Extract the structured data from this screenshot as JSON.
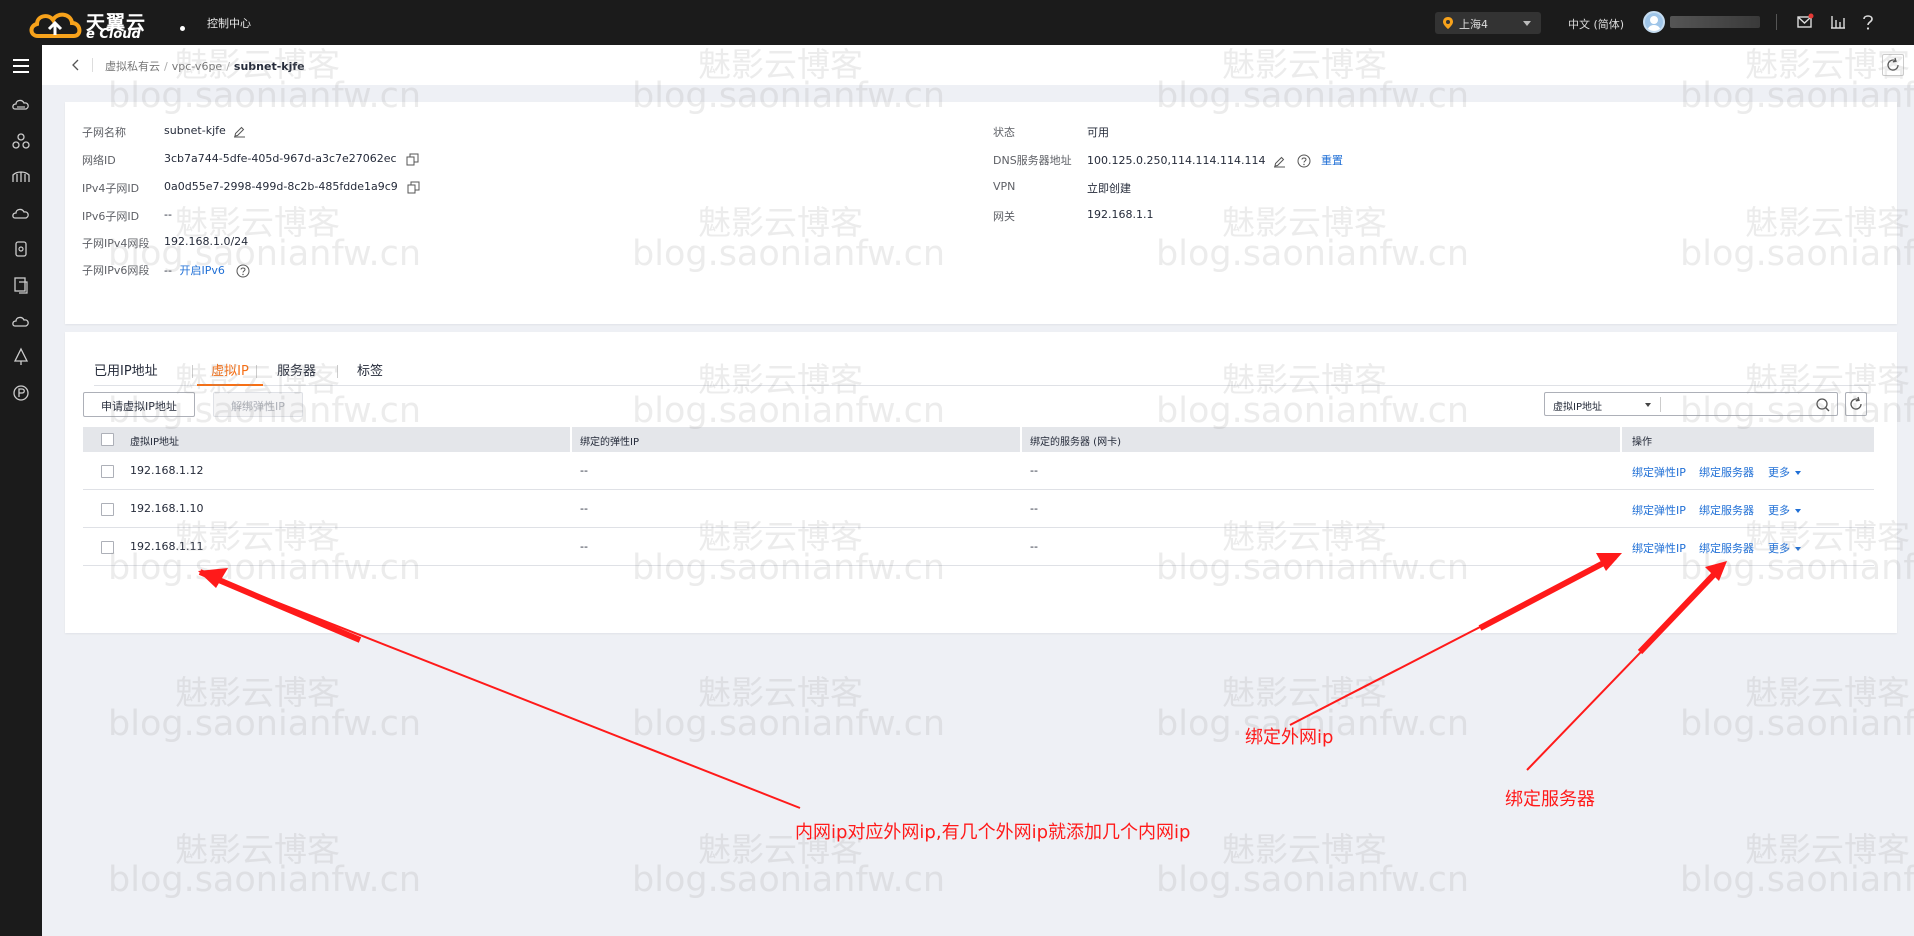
{
  "topbar": {
    "logo_cn": "天翼云",
    "logo_en": "e Cloud",
    "console_label": "控制中心",
    "region": "上海4",
    "language": "中文 (简体)"
  },
  "breadcrumb": {
    "items": [
      "虚拟私有云",
      "vpc-v6pe"
    ],
    "current": "subnet-kjfe"
  },
  "subnet_info": {
    "left": [
      {
        "key": "子网名称",
        "value": "subnet-kjfe"
      },
      {
        "key": "网络ID",
        "value": "3cb7a744-5dfe-405d-967d-a3c7e27062ec"
      },
      {
        "key": "IPv4子网ID",
        "value": "0a0d55e7-2998-499d-8c2b-485fdde1a9c9"
      },
      {
        "key": "IPv6子网ID",
        "value": "--"
      },
      {
        "key": "子网IPv4网段",
        "value": "192.168.1.0/24"
      },
      {
        "key": "子网IPv6网段",
        "value": "--",
        "link": "开启IPv6"
      }
    ],
    "right": [
      {
        "key": "状态",
        "value": "可用"
      },
      {
        "key": "DNS服务器地址",
        "value": "100.125.0.250,114.114.114.114",
        "link": "重置"
      },
      {
        "key": "VPN",
        "value": "",
        "link": "立即创建"
      },
      {
        "key": "网关",
        "value": "192.168.1.1"
      }
    ]
  },
  "tabs": [
    {
      "label": "已用IP地址",
      "active": false
    },
    {
      "label": "虚拟IP",
      "active": true
    },
    {
      "label": "服务器",
      "active": false
    },
    {
      "label": "标签",
      "active": false
    }
  ],
  "toolbar": {
    "apply_button": "申请虚拟IP地址",
    "unbind_button": "解绑弹性IP",
    "filter_select": "虚拟IP地址"
  },
  "table": {
    "headers": [
      "虚拟IP地址",
      "绑定的弹性IP",
      "绑定的服务器 (网卡)",
      "操作"
    ],
    "rows": [
      {
        "ip": "192.168.1.12",
        "eip": "--",
        "server": "--"
      },
      {
        "ip": "192.168.1.10",
        "eip": "--",
        "server": "--"
      },
      {
        "ip": "192.168.1.11",
        "eip": "--",
        "server": "--"
      }
    ],
    "actions": {
      "bind_eip": "绑定弹性IP",
      "bind_server": "绑定服务器",
      "more": "更多"
    }
  },
  "watermark": {
    "cn": "魅影云博客",
    "en": "blog.saonianfw.cn"
  },
  "annotations": {
    "bind_public": "绑定外网ip",
    "bind_server": "绑定服务器",
    "note": "内网ip对应外网ip,有几个外网ip就添加几个内网ip"
  },
  "colors": {
    "accent": "#f66f15",
    "link": "#1f6fd6",
    "annotation": "#ff1a1a",
    "topbar": "#1b1b1b"
  },
  "icons": [
    "menu-icon",
    "edit-icon",
    "copy-icon",
    "help-icon",
    "search-icon",
    "refresh-icon",
    "mail-icon",
    "chart-icon",
    "location-pin-icon"
  ]
}
